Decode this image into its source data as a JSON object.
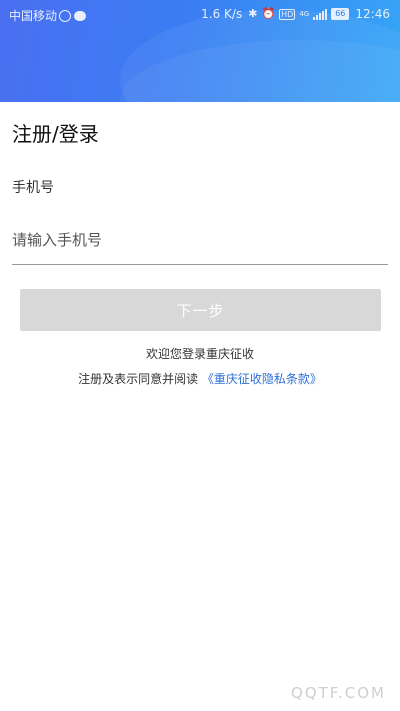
{
  "status_bar": {
    "carrier": "中国移动",
    "speed": "1.6 K/s",
    "hd_badge": "HD",
    "network_type": "4G",
    "battery": "66",
    "time": "12:46",
    "icons": [
      "circle-notification-icon",
      "chat-bubble-icon",
      "bluetooth-icon",
      "alarm-icon",
      "hd-icon",
      "signal-icon",
      "battery-icon"
    ]
  },
  "page": {
    "title": "注册/登录"
  },
  "form": {
    "phone_label": "手机号",
    "phone_placeholder": "请输入手机号",
    "phone_value": "",
    "next_label": "下一步"
  },
  "footer": {
    "welcome": "欢迎您登录重庆征收",
    "agreement_prefix": "注册及表示同意并阅读",
    "privacy_link": "《重庆征收隐私条款》"
  },
  "watermark": "QQTF.COM",
  "colors": {
    "header_gradient_start": "#4a6ff0",
    "header_gradient_end": "#36a6f6",
    "link": "#2d6fd6",
    "button_disabled": "#d8d8d8"
  }
}
